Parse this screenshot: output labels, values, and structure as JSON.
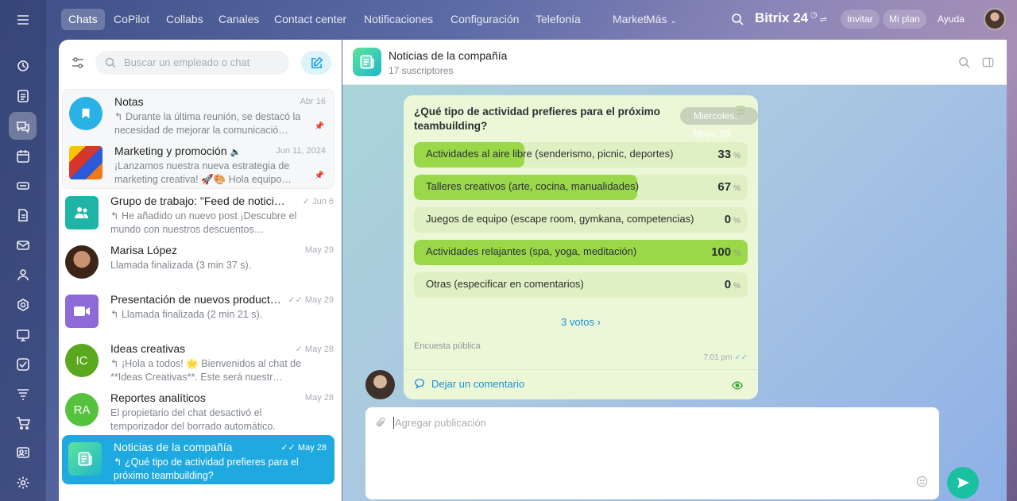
{
  "nav": {
    "items": [
      "Chats",
      "CoPilot",
      "Collabs",
      "Canales",
      "Contact center",
      "Notificaciones",
      "Configuración",
      "Telefonía",
      "Market",
      "Más"
    ],
    "brand": "Bitrix 24",
    "invite": "Invitar",
    "plan": "Mi plan",
    "help": "Ayuda"
  },
  "left_panel": {
    "search_placeholder": "Buscar un empleado o chat",
    "chats": [
      {
        "name": "Notas",
        "date": "Abr 16",
        "message": "Durante la última reunión, se destacó la necesidad de mejorar la comunicació…",
        "pinned": true,
        "avatar_color": "#2ab1e6"
      },
      {
        "name": "Marketing y promoción",
        "date": "Jun 11, 2024",
        "message": "¡Lanzamos nuestra nueva estrategia de marketing creativa! 🚀🎨 Hola equipo…",
        "pinned": true,
        "avatar_color": "#d8362b"
      },
      {
        "name": "Grupo de trabajo: \"Feed de notici…",
        "date": "Jun 6",
        "message": "He añadido un nuevo post ¡Descubre el mundo con nuestros descuentos…",
        "avatar_color": "#1eb5a6"
      },
      {
        "name": "Marisa López",
        "date": "May 29",
        "message": "Llamada finalizada (3 min 37 s).",
        "avatar_color": "#6b4a3a"
      },
      {
        "name": "Presentación de nuevos product…",
        "date": "May 29",
        "message": "Llamada finalizada (2 min 21 s).",
        "avatar_color": "#8e6ad8"
      },
      {
        "name": "Ideas creativas",
        "date": "May 28",
        "message": "¡Hola a todos! 🌟 Bienvenidos al chat de **Ideas Creativas**. Este será nuestr…",
        "avatar_text": "IC",
        "avatar_color": "#5aa81e"
      },
      {
        "name": "Reportes analíticos",
        "date": "May 28",
        "message": "El propietario del chat desactivó el temporizador del borrado automático.",
        "avatar_text": "RA",
        "avatar_color": "#54c23c"
      },
      {
        "name": "Noticias de la compañía",
        "date": "May 28",
        "message": "¿Qué tipo de actividad prefieres para el próximo teambuilding?",
        "avatar_color": "#3cc87a",
        "selected": true
      }
    ]
  },
  "chat": {
    "title": "Noticias de la compañía",
    "subtitle": "17 suscriptores",
    "date_pill": "Miercoles, Mayo 28",
    "poll": {
      "question": "¿Qué tipo de actividad prefieres para el próximo teambuilding?",
      "options": [
        {
          "label": "Actividades al aire libre (senderismo, picnic, deportes)",
          "percent": 33
        },
        {
          "label": "Talleres creativos (arte, cocina, manualidades)",
          "percent": 67
        },
        {
          "label": "Juegos de equipo (escape room, gymkana, competencias)",
          "percent": 0
        },
        {
          "label": "Actividades relajantes (spa, yoga, meditación)",
          "percent": 100
        },
        {
          "label": "Otras (especificar en comentarios)",
          "percent": 0
        }
      ],
      "percent_sign": "%",
      "votes": "3 votos",
      "type": "Encuesta pública",
      "time": "7:01 pm",
      "comment": "Dejar un comentario"
    },
    "composer_placeholder": "Agregar publicación"
  }
}
